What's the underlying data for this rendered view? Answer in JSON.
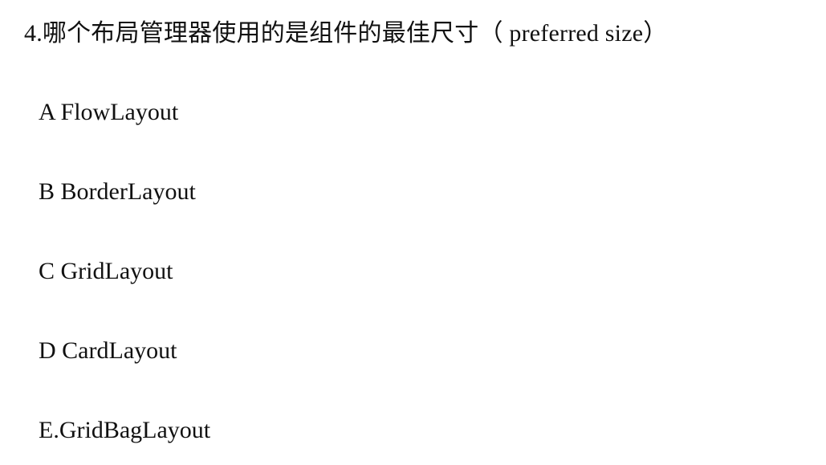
{
  "question": {
    "text": "4.哪个布局管理器使用的是组件的最佳尺寸（  preferred size）"
  },
  "options": [
    {
      "letter": "A",
      "sep": " ",
      "text": "FlowLayout"
    },
    {
      "letter": "B",
      "sep": " ",
      "text": "BorderLayout"
    },
    {
      "letter": "C",
      "sep": " ",
      "text": "GridLayout"
    },
    {
      "letter": "D",
      "sep": " ",
      "text": "CardLayout"
    },
    {
      "letter": "E",
      "sep": ".",
      "text": "GridBagLayout"
    }
  ]
}
